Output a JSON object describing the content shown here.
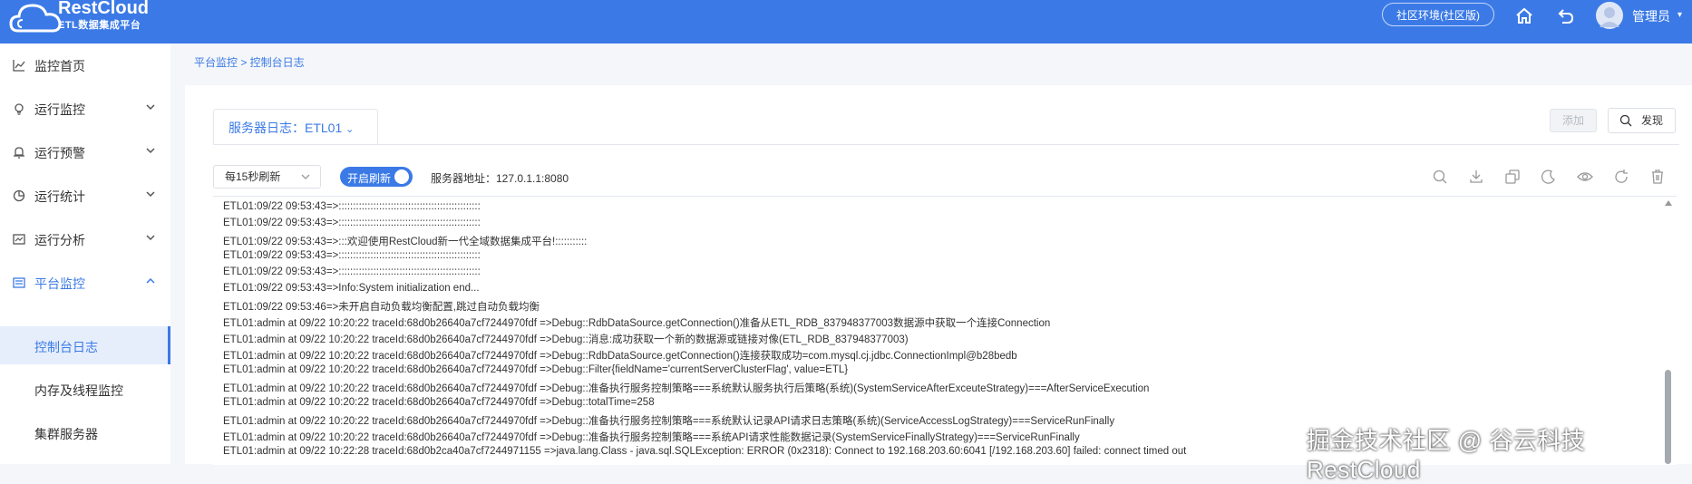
{
  "header": {
    "brand_title": "RestCloud",
    "brand_subtitle": "ETL数据集成平台",
    "env_label": "社区环境(社区版)",
    "user_name": "管理员",
    "accent_color": "#3b7ae6",
    "icons": [
      "cloud-logo",
      "home-icon",
      "back-icon",
      "avatar",
      "chevron-down-icon"
    ]
  },
  "sidebar": {
    "items": [
      {
        "label": "监控首页",
        "icon": "chart-line-icon"
      },
      {
        "label": "运行监控",
        "icon": "bulb-icon"
      },
      {
        "label": "运行预警",
        "icon": "bell-icon"
      },
      {
        "label": "运行统计",
        "icon": "pie-icon"
      },
      {
        "label": "运行分析",
        "icon": "analysis-icon"
      },
      {
        "label": "平台监控",
        "icon": "monitor-icon",
        "expanded": true
      }
    ],
    "sub_items": [
      {
        "label": "控制台日志",
        "active": true
      },
      {
        "label": "内存及线程监控"
      },
      {
        "label": "集群服务器"
      }
    ]
  },
  "breadcrumb": "平台监控 > 控制台日志",
  "tab": {
    "label": "服务器日志：ETL01"
  },
  "buttons": {
    "add": "添加",
    "find": "发现"
  },
  "toolbar": {
    "refresh_interval": "每15秒刷新",
    "auto_refresh_label": "开启刷新",
    "auto_refresh_on": true,
    "server_address": "服务器地址：127.0.1.1:8080",
    "tool_icons": [
      "search-icon",
      "download-icon",
      "copy-icon",
      "moon-icon",
      "eye-icon",
      "refresh-icon",
      "delete-icon"
    ]
  },
  "log_lines": [
    "ETL01:09/22 09:53:43=>:::::::::::::::::::::::::::::::::::::::::::::::::",
    "ETL01:09/22 09:53:43=>:::::::::::::::::::::::::::::::::::::::::::::::::",
    "ETL01:09/22 09:53:43=>:::欢迎使用RestCloud新一代全域数据集成平台!:::::::::::",
    "ETL01:09/22 09:53:43=>:::::::::::::::::::::::::::::::::::::::::::::::::",
    "ETL01:09/22 09:53:43=>:::::::::::::::::::::::::::::::::::::::::::::::::",
    "ETL01:09/22 09:53:43=>Info:System initialization end...",
    "ETL01:09/22 09:53:46=>未开启自动负载均衡配置,跳过自动负载均衡",
    "ETL01:admin at 09/22 10:20:22 traceId:68d0b26640a7cf7244970fdf =>Debug::RdbDataSource.getConnection()准备从ETL_RDB_837948377003数据源中获取一个连接Connection",
    "ETL01:admin at 09/22 10:20:22 traceId:68d0b26640a7cf7244970fdf =>Debug::消息:成功获取一个新的数据源或链接对像(ETL_RDB_837948377003)",
    "ETL01:admin at 09/22 10:20:22 traceId:68d0b26640a7cf7244970fdf =>Debug::RdbDataSource.getConnection()连接获取成功=com.mysql.cj.jdbc.ConnectionImpl@b28bedb",
    "ETL01:admin at 09/22 10:20:22 traceId:68d0b26640a7cf7244970fdf =>Debug::Filter{fieldName='currentServerClusterFlag', value=ETL}",
    "ETL01:admin at 09/22 10:20:22 traceId:68d0b26640a7cf7244970fdf =>Debug::准备执行服务控制策略===系统默认服务执行后策略(系统)(SystemServiceAfterExceuteStrategy)===AfterServiceExecution",
    "ETL01:admin at 09/22 10:20:22 traceId:68d0b26640a7cf7244970fdf =>Debug::totalTime=258",
    "ETL01:admin at 09/22 10:20:22 traceId:68d0b26640a7cf7244970fdf =>Debug::准备执行服务控制策略===系统默认记录API请求日志策略(系统)(ServiceAccessLogStrategy)===ServiceRunFinally",
    "ETL01:admin at 09/22 10:20:22 traceId:68d0b26640a7cf7244970fdf =>Debug::准备执行服务控制策略===系统API请求性能数据记录(SystemServiceFinallyStrategy)===ServiceRunFinally",
    "ETL01:admin at 09/22 10:22:28 traceId:68d0b2ca40a7cf7244971155 =>java.lang.Class - java.sql.SQLException: ERROR (0x2318): Connect to 192.168.203.60:6041 [/192.168.203.60] failed: connect timed out"
  ],
  "watermark": "掘金技术社区 @ 谷云科技RestCloud"
}
